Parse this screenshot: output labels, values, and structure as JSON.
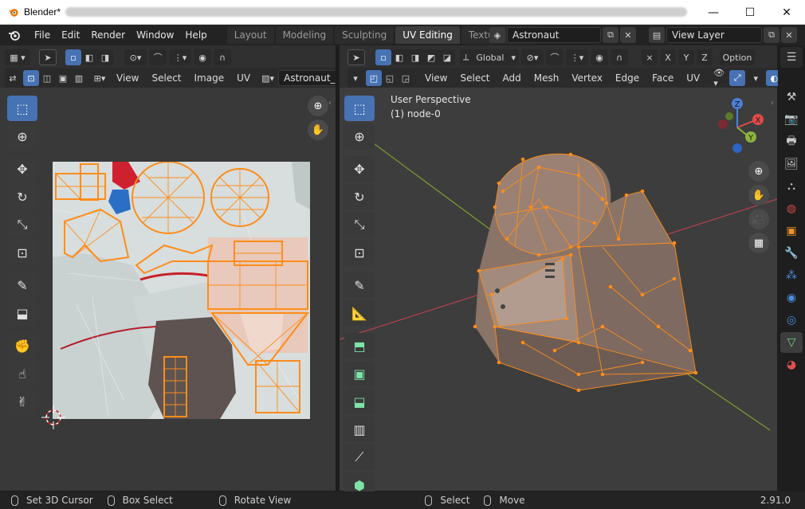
{
  "window": {
    "title": "Blender*",
    "controls": {
      "minimize": "—",
      "maximize": "☐",
      "close": "✕"
    }
  },
  "topbar": {
    "menu": [
      "File",
      "Edit",
      "Render",
      "Window",
      "Help"
    ],
    "workspaces": [
      "Layout",
      "Modeling",
      "Sculpting",
      "UV Editing",
      "Texture Paint"
    ],
    "active_workspace": "UV Editing",
    "scene_name": "Astronaut",
    "view_layer": "View Layer"
  },
  "uv_editor": {
    "header_menus": [
      "View",
      "Select",
      "Image",
      "UV"
    ],
    "image_name": "Astronaut_",
    "tools": [
      "select-box-icon",
      "cursor-icon",
      "move-icon",
      "rotate-icon",
      "scale-icon",
      "transform-icon",
      "annotate-icon",
      "cube-project-icon",
      "grab-icon",
      "relax-icon",
      "pinch-icon"
    ]
  },
  "viewport": {
    "orientation": "Global",
    "header_menus": [
      "View",
      "Select",
      "Add",
      "Mesh",
      "Vertex",
      "Edge",
      "Face",
      "UV"
    ],
    "options_label": "Option",
    "axis_labels": [
      "X",
      "Y",
      "Z"
    ],
    "perspective_label": "User Perspective",
    "object_label": "(1) node-0",
    "gizmo": {
      "x": "X",
      "y": "Y",
      "z": "Z"
    },
    "tools": [
      "select-box-icon",
      "cursor-icon",
      "move-icon",
      "rotate-icon",
      "scale-icon",
      "transform-icon",
      "annotate-icon",
      "measure-icon",
      "extrude-icon",
      "inset-icon",
      "bevel-icon",
      "loopcut-icon",
      "knife-icon",
      "polybuild-icon"
    ]
  },
  "statusbar": {
    "items": [
      "Set 3D Cursor",
      "Box Select",
      "Rotate View",
      "Select",
      "Move"
    ],
    "version": "2.91.0"
  },
  "colors": {
    "accent": "#4772b3",
    "mesh_orange": "#ff8c1a",
    "x_axis": "#e04a4a",
    "y_axis": "#8db33d",
    "z_axis": "#4b80d6"
  }
}
